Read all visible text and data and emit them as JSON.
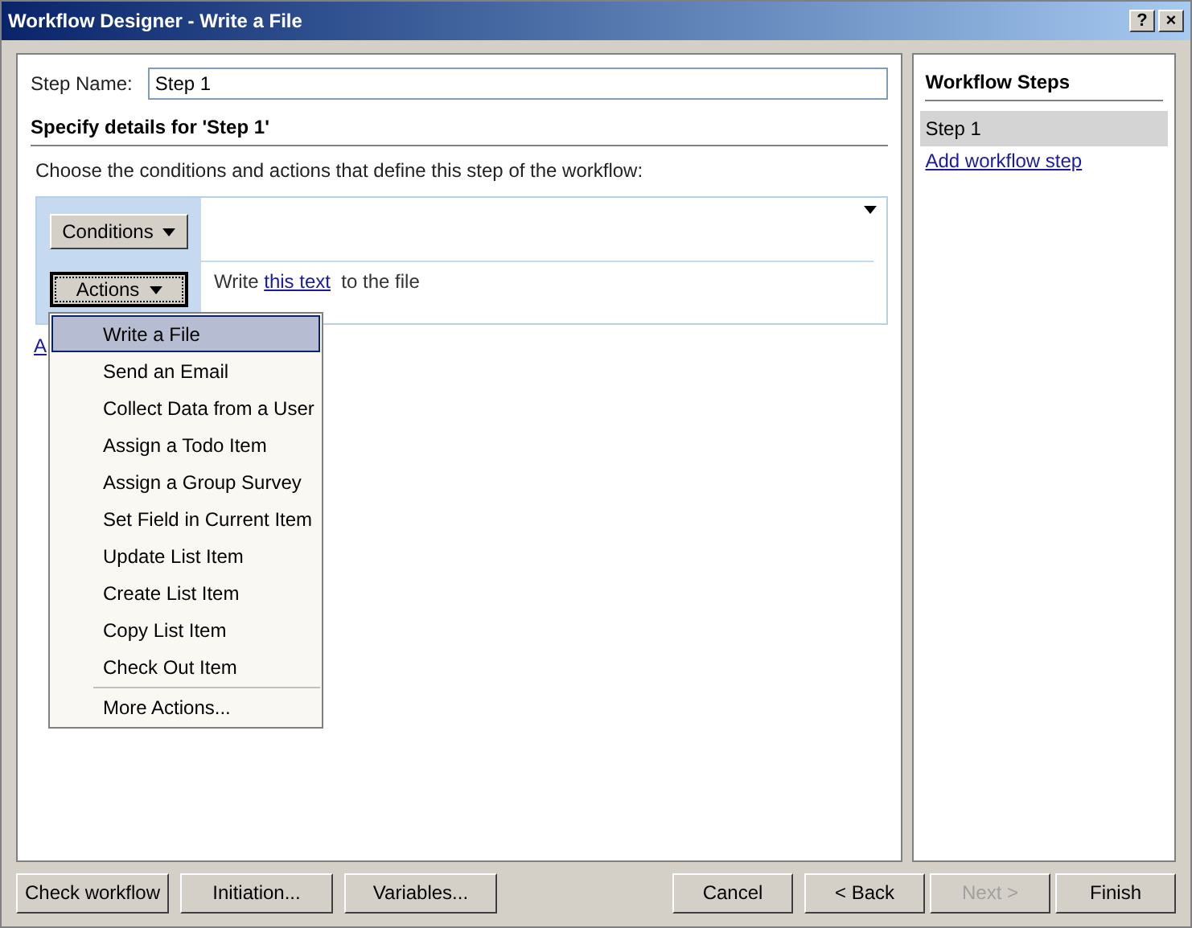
{
  "window": {
    "title": "Workflow Designer - Write a File",
    "title_buttons": [
      "?",
      "×"
    ]
  },
  "step_name": {
    "label": "Step Name:",
    "value": "Step 1"
  },
  "details": {
    "heading": "Specify details for 'Step 1'",
    "instruction": "Choose the conditions and actions that define this step of the workflow:",
    "conditions_button": "Conditions",
    "actions_button": "Actions",
    "action_text": {
      "before": "Write",
      "link": "this text",
      "after": "to the file"
    },
    "partial_link": "A"
  },
  "actions_menu": {
    "items": [
      {
        "label": "Write a File",
        "selected": true
      },
      {
        "label": "Send an Email",
        "selected": false
      },
      {
        "label": "Collect Data from a User",
        "selected": false
      },
      {
        "label": "Assign a Todo Item",
        "selected": false
      },
      {
        "label": "Assign a Group Survey",
        "selected": false
      },
      {
        "label": "Set Field in Current Item",
        "selected": false
      },
      {
        "label": "Update List Item",
        "selected": false
      },
      {
        "label": "Create List Item",
        "selected": false
      },
      {
        "label": "Copy List Item",
        "selected": false
      },
      {
        "label": "Check Out Item",
        "selected": false
      }
    ],
    "more": "More Actions..."
  },
  "workflow_steps": {
    "title": "Workflow Steps",
    "steps": [
      {
        "label": "Step 1",
        "selected": true
      }
    ],
    "add_link": "Add workflow step"
  },
  "left_buttons": [
    {
      "label": "Check workflow",
      "disabled": false
    },
    {
      "label": "Initiation...",
      "disabled": false
    },
    {
      "label": "Variables...",
      "disabled": false
    }
  ],
  "right_buttons": [
    {
      "label": "Cancel",
      "disabled": false
    },
    {
      "label": "< Back",
      "disabled": false
    },
    {
      "label": "Next >",
      "disabled": true
    },
    {
      "label": "Finish",
      "disabled": false
    }
  ]
}
